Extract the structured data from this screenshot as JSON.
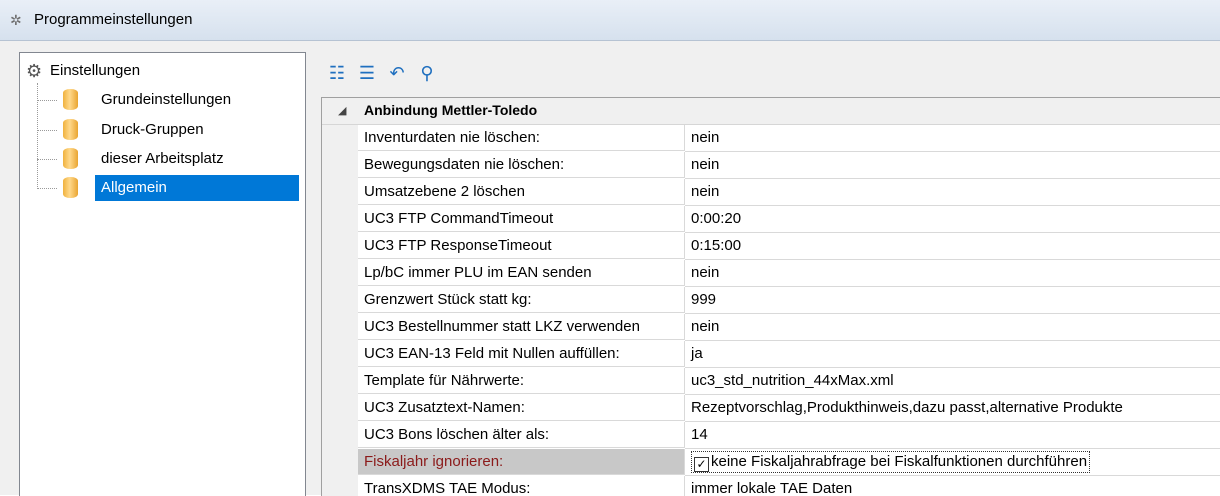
{
  "window": {
    "title": "Programmeinstellungen",
    "icon": "gear-icon"
  },
  "tree": {
    "root_label": "Einstellungen",
    "items": [
      {
        "label": "Grundeinstellungen",
        "selected": false
      },
      {
        "label": "Druck-Gruppen",
        "selected": false
      },
      {
        "label": "dieser Arbeitsplatz",
        "selected": false
      },
      {
        "label": "Allgemein",
        "selected": true
      }
    ]
  },
  "toolbar": {
    "buttons": [
      {
        "icon": "categorized-view-icon"
      },
      {
        "icon": "alphabetical-view-icon"
      },
      {
        "icon": "undo-icon"
      },
      {
        "icon": "search-icon"
      }
    ]
  },
  "grid": {
    "category": "Anbindung Mettler-Toledo",
    "rows": [
      {
        "name": "Inventurdaten nie löschen:",
        "value": "nein"
      },
      {
        "name": "Bewegungsdaten nie löschen:",
        "value": "nein"
      },
      {
        "name": "Umsatzebene 2 löschen",
        "value": "nein"
      },
      {
        "name": "UC3 FTP CommandTimeout",
        "value": "0:00:20"
      },
      {
        "name": "UC3 FTP ResponseTimeout",
        "value": "0:15:00"
      },
      {
        "name": "Lp/bC immer PLU im EAN senden",
        "value": "nein"
      },
      {
        "name": "Grenzwert Stück statt kg:",
        "value": "999"
      },
      {
        "name": "UC3 Bestellnummer statt LKZ verwenden",
        "value": "nein"
      },
      {
        "name": "UC3 EAN-13 Feld mit Nullen auffüllen:",
        "value": "ja"
      },
      {
        "name": "Template für Nährwerte:",
        "value": "uc3_std_nutrition_44xMax.xml"
      },
      {
        "name": "UC3 Zusatztext-Namen:",
        "value": "Rezeptvorschlag,Produkthinweis,dazu passt,alternative Produkte"
      },
      {
        "name": "UC3 Bons löschen älter als:",
        "value": "14"
      },
      {
        "name": "Fiskaljahr ignorieren:",
        "value": "keine Fiskaljahrabfrage bei Fiskalfunktionen durchführen",
        "checked": true
      },
      {
        "name": "TransXDMS TAE Modus:",
        "value": "immer lokale TAE Daten"
      }
    ],
    "selected_row": 12
  }
}
